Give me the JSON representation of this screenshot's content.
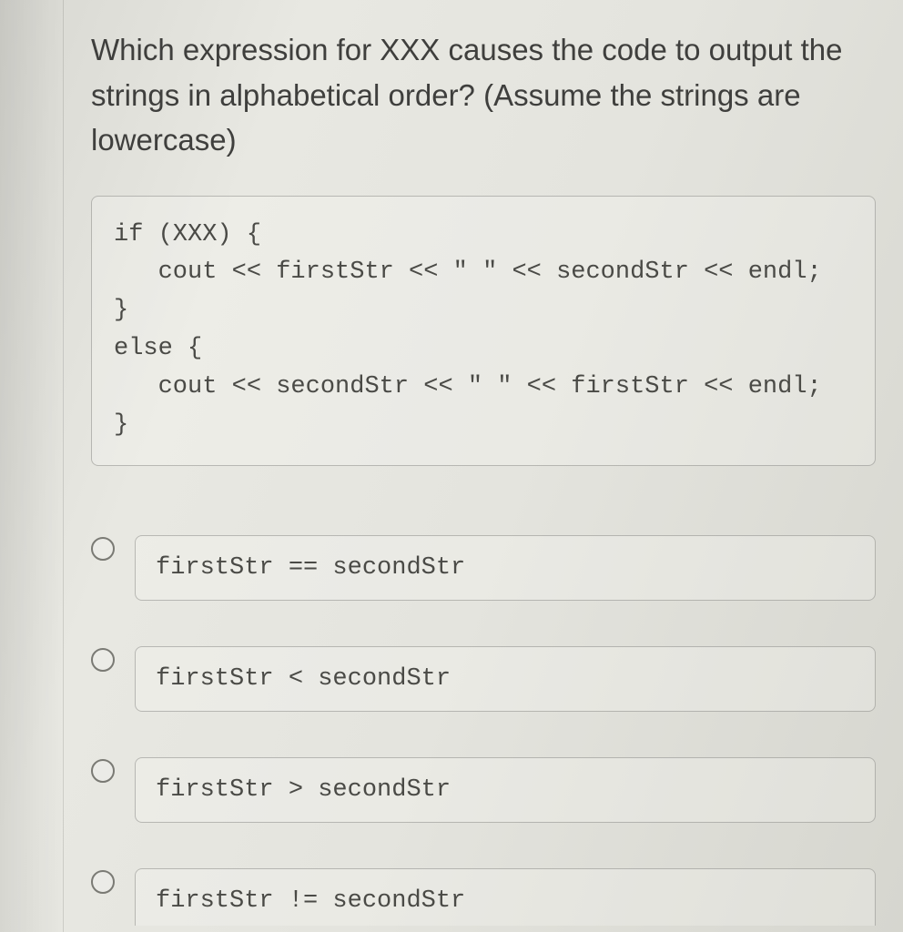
{
  "question": "Which expression for XXX causes the code to output the strings in alphabetical order? (Assume the strings are lowercase)",
  "code": "if (XXX) {\n   cout << firstStr << \" \" << secondStr << endl;\n}\nelse {\n   cout << secondStr << \" \" << firstStr << endl;\n}",
  "options": [
    {
      "label": "firstStr == secondStr"
    },
    {
      "label": "firstStr < secondStr"
    },
    {
      "label": "firstStr > secondStr"
    },
    {
      "label": "firstStr != secondStr"
    }
  ]
}
